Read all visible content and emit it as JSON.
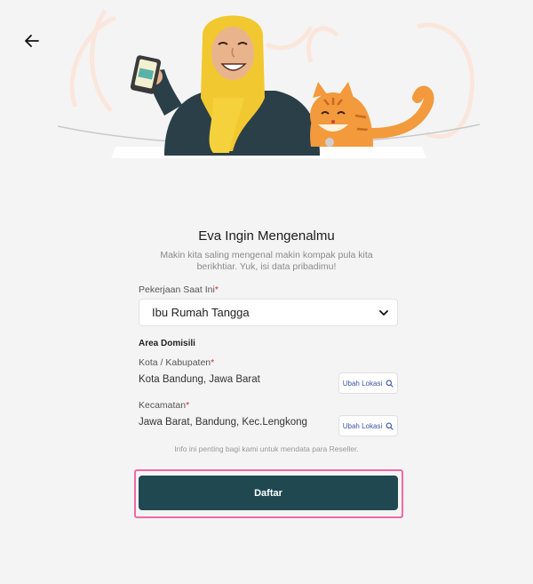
{
  "header": {
    "back_icon": "arrow-left-icon"
  },
  "hero": {
    "illustration": "woman-with-phone-and-cat"
  },
  "intro": {
    "title": "Eva Ingin Mengenalmu",
    "subtitle": "Makin kita saling mengenal makin kompak pula kita berikhtiar. Yuk, isi data pribadimu!"
  },
  "job": {
    "label": "Pekerjaan Saat Ini",
    "required_mark": "*",
    "value": "Ibu Rumah Tangga"
  },
  "domicile": {
    "section_title": "Area Domisili",
    "city": {
      "label": "Kota / Kabupaten",
      "required_mark": "*",
      "value": "Kota Bandung, Jawa Barat",
      "button_label": "Ubah Lokasi"
    },
    "district": {
      "label": "Kecamatan",
      "required_mark": "*",
      "value": "Jawa Barat, Bandung, Kec.Lengkong",
      "button_label": "Ubah Lokasi"
    }
  },
  "info_text": "Info ini penting bagi kami untuk mendata para Reseller.",
  "submit": {
    "label": "Daftar"
  },
  "colors": {
    "primary": "#1f4851",
    "highlight": "#f06aa7",
    "link": "#3a54a8",
    "required": "#d32f2f"
  }
}
